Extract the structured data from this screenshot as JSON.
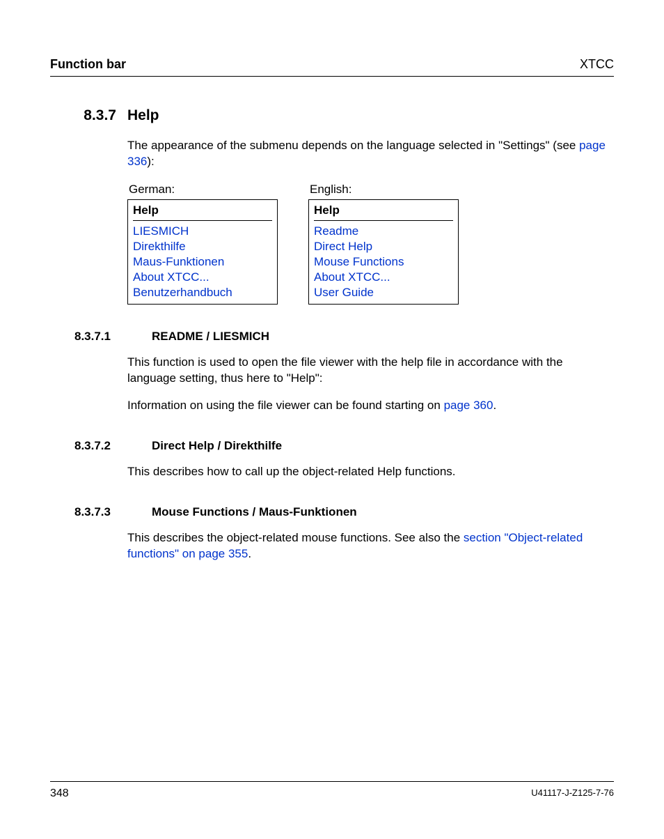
{
  "header": {
    "left": "Function bar",
    "right": "XTCC"
  },
  "section": {
    "number": "8.3.7",
    "title": "Help",
    "intro_text_1": "The appearance of the submenu depends on the language selected in \"Settings\" (see ",
    "intro_link": "page 336",
    "intro_text_2": "):"
  },
  "menus": {
    "german": {
      "label": "German:",
      "title": "Help",
      "items": [
        "LIESMICH",
        "Direkthilfe",
        "Maus-Funktionen",
        "About XTCC...",
        "Benutzerhandbuch"
      ]
    },
    "english": {
      "label": "English:",
      "title": "Help",
      "items": [
        "Readme",
        "Direct Help",
        "Mouse Functions",
        "About XTCC...",
        "User Guide"
      ]
    }
  },
  "subsections": [
    {
      "number": "8.3.7.1",
      "title": "README / LIESMICH",
      "paragraphs": [
        {
          "segments": [
            {
              "text": "This function is used to open the file viewer with the help file in accordance with the language setting, thus here to \"Help\":"
            }
          ]
        },
        {
          "segments": [
            {
              "text": "Information on using the file viewer can be found starting on "
            },
            {
              "link": "page 360"
            },
            {
              "text": "."
            }
          ]
        }
      ]
    },
    {
      "number": "8.3.7.2",
      "title": "Direct Help / Direkthilfe",
      "paragraphs": [
        {
          "segments": [
            {
              "text": "This describes how to call up the object-related Help functions."
            }
          ]
        }
      ]
    },
    {
      "number": "8.3.7.3",
      "title": "Mouse Functions / Maus-Funktionen",
      "paragraphs": [
        {
          "segments": [
            {
              "text": "This describes the object-related mouse functions. See also the "
            },
            {
              "link": "section \"Object-related functions\" on page 355"
            },
            {
              "text": "."
            }
          ]
        }
      ]
    }
  ],
  "footer": {
    "page_number": "348",
    "doc_id": "U41117-J-Z125-7-76"
  }
}
